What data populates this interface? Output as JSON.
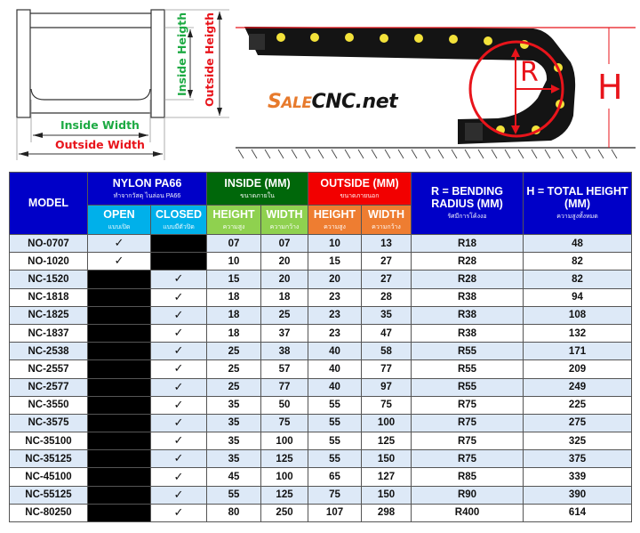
{
  "diagram": {
    "inside_height": "Inside Heigth",
    "outside_height": "Outside Heigth",
    "inside_width": "Inside Width",
    "outside_width": "Outside Width",
    "radius_label": "R",
    "height_label": "H",
    "logo_sale_first": "S",
    "logo_sale_rest": "ALE",
    "logo_cnc": "CNC.net"
  },
  "colors": {
    "header_blue": "#0000c8",
    "header_cyan": "#00b0ea",
    "inside_green": "#00670a",
    "inside_light_green": "#8fd14f",
    "outside_red": "#f20000",
    "outside_orange": "#ee7d31",
    "row_alt": "#dde9f7",
    "check_mark": "✓"
  },
  "table": {
    "headers": {
      "model": "MODEL",
      "nylon": "NYLON PA66",
      "nylon_sub": "ทำจากวัสดุ ไนล่อน PA66",
      "inside": "INSIDE (MM)",
      "inside_sub": "ขนาดภายใน",
      "outside": "OUTSIDE (MM)",
      "outside_sub": "ขนาดภายนอก",
      "radius": "R = BENDING RADIUS (MM)",
      "radius_sub": "รัศมีการโค้งงอ",
      "total_height": "H = TOTAL HEIGHT (MM)",
      "total_height_sub": "ความสูงทั้งหมด",
      "open": "OPEN",
      "open_sub": "แบบเปิด",
      "closed": "CLOSED",
      "closed_sub": "แบบมีตัวปิด",
      "in_height": "HEIGHT",
      "in_height_sub": "ความสูง",
      "in_width": "WIDTH",
      "in_width_sub": "ความกว้าง",
      "out_height": "HEIGHT",
      "out_height_sub": "ความสูง",
      "out_width": "WIDTH",
      "out_width_sub": "ความกว้าง"
    },
    "rows": [
      {
        "model": "NO-0707",
        "open": true,
        "closed": false,
        "in_h": "07",
        "in_w": "07",
        "out_h": "10",
        "out_w": "13",
        "r": "R18",
        "h": "48"
      },
      {
        "model": "NO-1020",
        "open": true,
        "closed": false,
        "in_h": "10",
        "in_w": "20",
        "out_h": "15",
        "out_w": "27",
        "r": "R28",
        "h": "82"
      },
      {
        "model": "NC-1520",
        "open": false,
        "closed": true,
        "in_h": "15",
        "in_w": "20",
        "out_h": "20",
        "out_w": "27",
        "r": "R28",
        "h": "82"
      },
      {
        "model": "NC-1818",
        "open": false,
        "closed": true,
        "in_h": "18",
        "in_w": "18",
        "out_h": "23",
        "out_w": "28",
        "r": "R38",
        "h": "94"
      },
      {
        "model": "NC-1825",
        "open": false,
        "closed": true,
        "in_h": "18",
        "in_w": "25",
        "out_h": "23",
        "out_w": "35",
        "r": "R38",
        "h": "108"
      },
      {
        "model": "NC-1837",
        "open": false,
        "closed": true,
        "in_h": "18",
        "in_w": "37",
        "out_h": "23",
        "out_w": "47",
        "r": "R38",
        "h": "132"
      },
      {
        "model": "NC-2538",
        "open": false,
        "closed": true,
        "in_h": "25",
        "in_w": "38",
        "out_h": "40",
        "out_w": "58",
        "r": "R55",
        "h": "171"
      },
      {
        "model": "NC-2557",
        "open": false,
        "closed": true,
        "in_h": "25",
        "in_w": "57",
        "out_h": "40",
        "out_w": "77",
        "r": "R55",
        "h": "209"
      },
      {
        "model": "NC-2577",
        "open": false,
        "closed": true,
        "in_h": "25",
        "in_w": "77",
        "out_h": "40",
        "out_w": "97",
        "r": "R55",
        "h": "249"
      },
      {
        "model": "NC-3550",
        "open": false,
        "closed": true,
        "in_h": "35",
        "in_w": "50",
        "out_h": "55",
        "out_w": "75",
        "r": "R75",
        "h": "225"
      },
      {
        "model": "NC-3575",
        "open": false,
        "closed": true,
        "in_h": "35",
        "in_w": "75",
        "out_h": "55",
        "out_w": "100",
        "r": "R75",
        "h": "275"
      },
      {
        "model": "NC-35100",
        "open": false,
        "closed": true,
        "in_h": "35",
        "in_w": "100",
        "out_h": "55",
        "out_w": "125",
        "r": "R75",
        "h": "325"
      },
      {
        "model": "NC-35125",
        "open": false,
        "closed": true,
        "in_h": "35",
        "in_w": "125",
        "out_h": "55",
        "out_w": "150",
        "r": "R75",
        "h": "375"
      },
      {
        "model": "NC-45100",
        "open": false,
        "closed": true,
        "in_h": "45",
        "in_w": "100",
        "out_h": "65",
        "out_w": "127",
        "r": "R85",
        "h": "339"
      },
      {
        "model": "NC-55125",
        "open": false,
        "closed": true,
        "in_h": "55",
        "in_w": "125",
        "out_h": "75",
        "out_w": "150",
        "r": "R90",
        "h": "390"
      },
      {
        "model": "NC-80250",
        "open": false,
        "closed": true,
        "in_h": "80",
        "in_w": "250",
        "out_h": "107",
        "out_w": "298",
        "r": "R400",
        "h": "614"
      }
    ]
  }
}
